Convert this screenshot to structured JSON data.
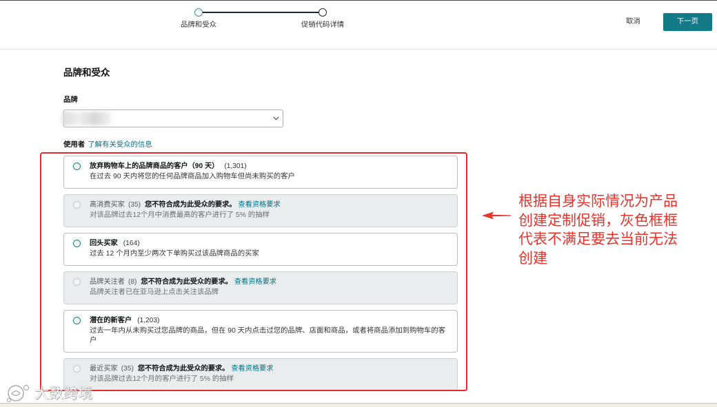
{
  "stepper": {
    "steps": [
      {
        "label": "品牌和受众"
      },
      {
        "label": "促销代码详情"
      }
    ]
  },
  "header": {
    "cancel_label": "取消",
    "next_label": "下一页"
  },
  "brand_audience": {
    "title": "品牌和受众",
    "brand_label": "品牌",
    "audience_label": "使用者",
    "audience_help_link": "了解有关受众的信息"
  },
  "audiences": [
    {
      "name": "放弃购物车上的品牌商品的客户（90 天）",
      "count": "(1,301)",
      "description": "在过去 90 天内将您的任何品牌商品加入购物车但尚未购买的客户",
      "eligible": true
    },
    {
      "name": "高消费买家",
      "count": "(35)",
      "ineligible_message": "您不符合成为此受众的要求。",
      "requirements_link": "查看资格要求",
      "description": "对该品牌过去12个月中消费最高的客户进行了 5% 的抽样",
      "eligible": false
    },
    {
      "name": "回头买家",
      "count": "(164)",
      "description": "过去 12 个月内至少两次下单购买过该品牌商品的买家",
      "eligible": true
    },
    {
      "name": "品牌关注者",
      "count": "(8)",
      "ineligible_message": "您不符合成为此受众的要求。",
      "requirements_link": "查看资格要求",
      "description": "品牌关注者已在亚马逊上点击关注该品牌",
      "eligible": false
    },
    {
      "name": "潜在的新客户",
      "count": "(1,203)",
      "description": "过去一年内从未购买过您品牌的商品，但在 90 天内点击过您的品牌、店面和商品，或者将商品添加到购物车的客户",
      "eligible": true
    },
    {
      "name": "最近买家",
      "count": "(35)",
      "ineligible_message": "您不符合成为此受众的要求。",
      "requirements_link": "查看资格要求",
      "description": "对该品牌过去12个月的客户进行了 5% 的抽样",
      "eligible": false
    }
  ],
  "annotation": {
    "text": "根据自身实际情况为产品创建定制促销，灰色框框代表不满足要去当前无法创建",
    "icon": "left-arrow-icon"
  },
  "watermark": {
    "text": "大数跨境"
  },
  "icons": {
    "select_chevron": "chevron-down-icon",
    "radio": "radio-circle-icon"
  },
  "colors": {
    "accent": "#137a87",
    "link": "#007185",
    "annotation_red": "#e8332c",
    "disabled_card_bg": "#eaeded"
  }
}
